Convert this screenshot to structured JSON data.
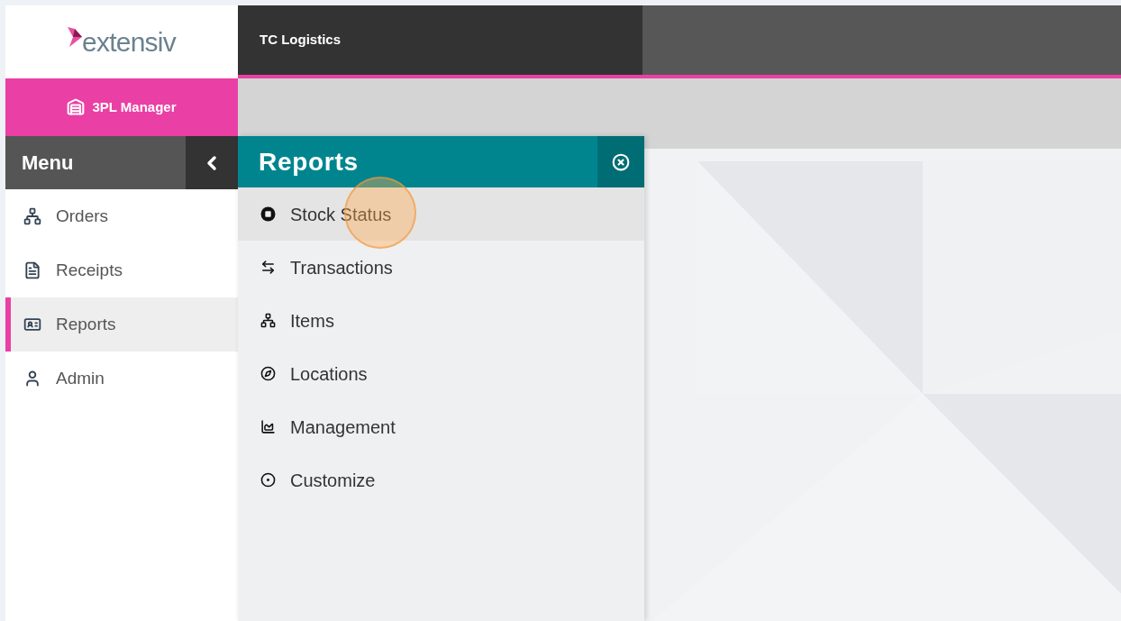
{
  "logo": {
    "text": "extensiv"
  },
  "app": {
    "name": "3PL Manager"
  },
  "header": {
    "company": "TC Logistics"
  },
  "menu": {
    "title": "Menu",
    "items": [
      {
        "label": "Orders",
        "selected": false
      },
      {
        "label": "Receipts",
        "selected": false
      },
      {
        "label": "Reports",
        "selected": true
      },
      {
        "label": "Admin",
        "selected": false
      }
    ]
  },
  "submenu": {
    "title": "Reports",
    "items": [
      {
        "label": "Stock Status",
        "selected": true,
        "clicked": true
      },
      {
        "label": "Transactions",
        "selected": false,
        "clicked": false
      },
      {
        "label": "Items",
        "selected": false,
        "clicked": false
      },
      {
        "label": "Locations",
        "selected": false,
        "clicked": false
      },
      {
        "label": "Management",
        "selected": false,
        "clicked": false
      },
      {
        "label": "Customize",
        "selected": false,
        "clicked": false
      }
    ]
  }
}
